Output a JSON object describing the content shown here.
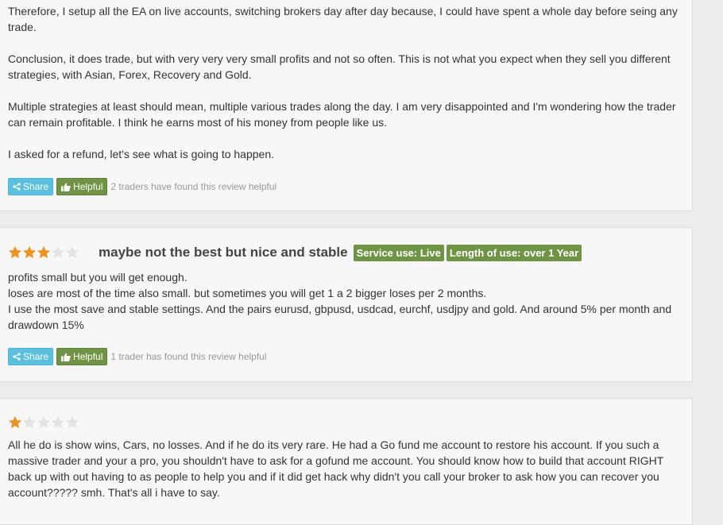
{
  "colors": {
    "share_button": "#5bc0de",
    "helpful_button": "#6f9443",
    "tag_background": "#6f9443",
    "star_filled": "#f0921e",
    "star_empty": "#e3e3e3"
  },
  "reviews": [
    {
      "paragraphs": [
        "Therefore, I setup all the EA on live accounts, switching brokers day after day because, I could have spent a whole day before seing any trade.",
        "Conclusion, it does trade, but with very very very small profits and not so often. This is not what you expect when they sell you different strategies, with Asian, Forex, Recovery and Gold.",
        "Multiple strategies at least should mean, multiple various trades along the day. I am very disappointed and I'm wondering how the trader can remain profitable. I think he earns most of his money from people like us.",
        "I asked for a refund, let's see what is going to happen."
      ],
      "share_label": "Share",
      "helpful_label": "Helpful",
      "helpful_count_text": "2 traders have found this review helpful"
    },
    {
      "rating": 3,
      "rating_max": 5,
      "title": "maybe not the best but nice and stable",
      "tags": [
        "Service use: Live",
        "Length of use: over 1 Year"
      ],
      "lines": [
        "profits small but you will get enough.",
        "loses are most of the time also small. but sometimes you will get 1 a 2 bigger loses per 2 months.",
        "I use the most save and stable settings. And the pairs eurusd, gbpusd, usdcad, eurchf, usdjpy and gold. And around 5% per month and drawdown 15%"
      ],
      "share_label": "Share",
      "helpful_label": "Helpful",
      "helpful_count_text": "1 trader has found this review helpful"
    },
    {
      "rating": 1,
      "rating_max": 5,
      "text": "All he do is show wins, Cars, no losses. And if he do its very rare. He had a Go fund me account to restore his account. If you such a massive trader and your a pro, you shouldn't have to ask for a gofund me account. You should know how to build that account RIGHT back up with out having to as people to help you and if it did get hack why didn't you call your broker to ask how you can recover you account????? smh. That's all i have to say."
    }
  ]
}
